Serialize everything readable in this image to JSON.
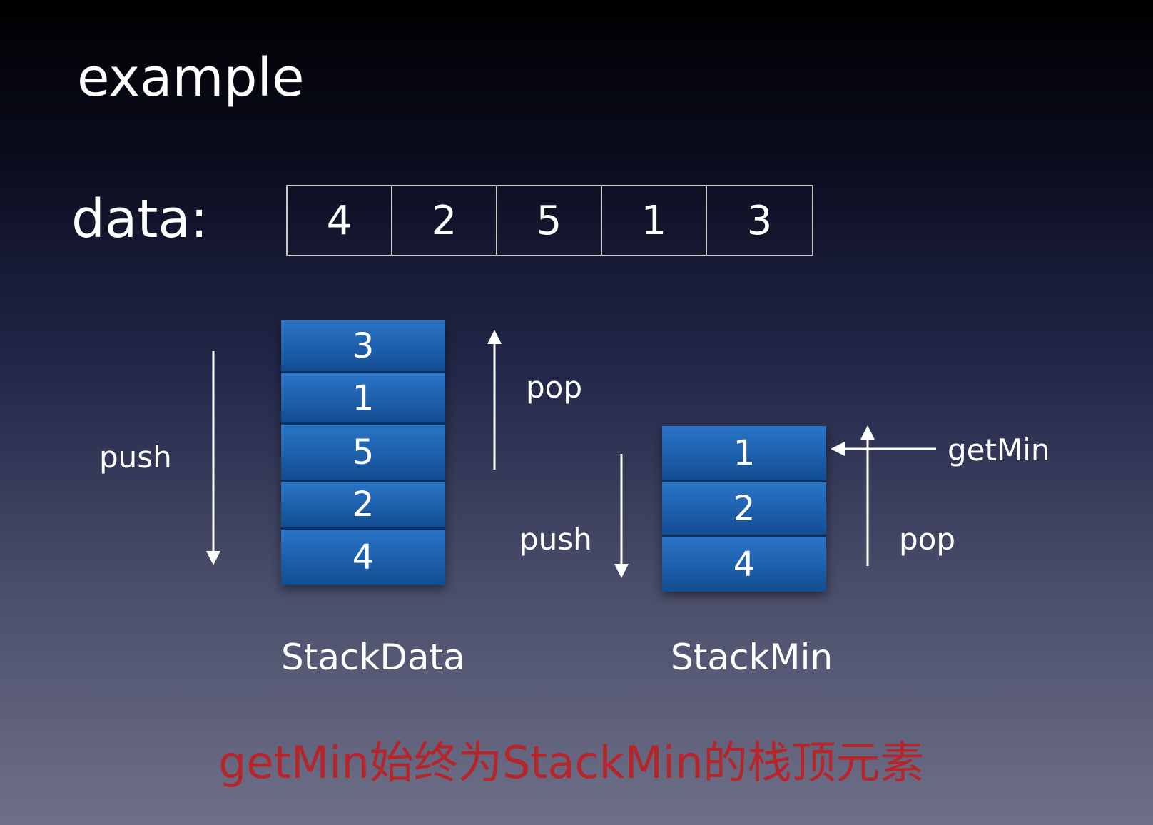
{
  "title": "example",
  "data_label": "data:",
  "data_array": [
    "4",
    "2",
    "5",
    "1",
    "3"
  ],
  "stack_data": {
    "name": "StackData",
    "items": [
      "3",
      "1",
      "5",
      "2",
      "4"
    ],
    "push_label": "push",
    "pop_label": "pop"
  },
  "stack_min": {
    "name": "StackMin",
    "items": [
      "1",
      "2",
      "4"
    ],
    "push_label": "push",
    "pop_label": "pop",
    "getmin_label": "getMin"
  },
  "caption": "getMin始终为StackMin的栈顶元素",
  "colors": {
    "block_blue": "#1d5fab",
    "caption_red": "#b5252a",
    "arrow": "#ffffff"
  }
}
